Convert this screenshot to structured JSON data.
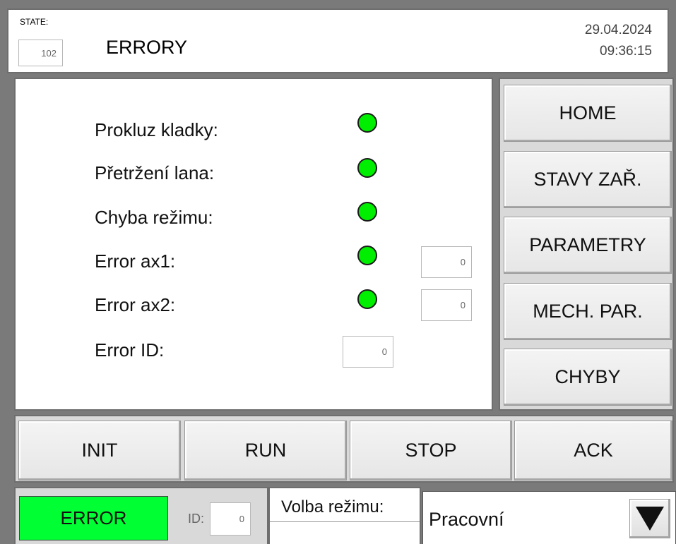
{
  "header": {
    "state_label": "STATE:",
    "state_value": "102",
    "title": "ERRORY",
    "date": "29.04.2024",
    "time": "09:36:15"
  },
  "errors": [
    {
      "label": "Prokluz kladky:",
      "led": "ok"
    },
    {
      "label": "Přetržení lana:",
      "led": "ok"
    },
    {
      "label": "Chyba režimu:",
      "led": "ok"
    },
    {
      "label": "Error ax1:",
      "led": "ok",
      "value": "0"
    },
    {
      "label": "Error ax2:",
      "led": "ok",
      "value": "0"
    },
    {
      "label": "Error ID:",
      "value": "0"
    }
  ],
  "nav": {
    "home": "HOME",
    "stavy": "STAVY ZAŘ.",
    "parametry": "PARAMETRY",
    "mech": "MECH. PAR.",
    "chyby": "CHYBY"
  },
  "controls": {
    "init": "INIT",
    "run": "RUN",
    "stop": "STOP",
    "ack": "ACK"
  },
  "status": {
    "state": "ERROR",
    "id_label": "ID:",
    "id_value": "0",
    "mode_label": "Volba režimu:",
    "mode_value": "Pracovní"
  },
  "colors": {
    "led_ok": "#00ee00",
    "error_indicator": "#00ff33"
  }
}
